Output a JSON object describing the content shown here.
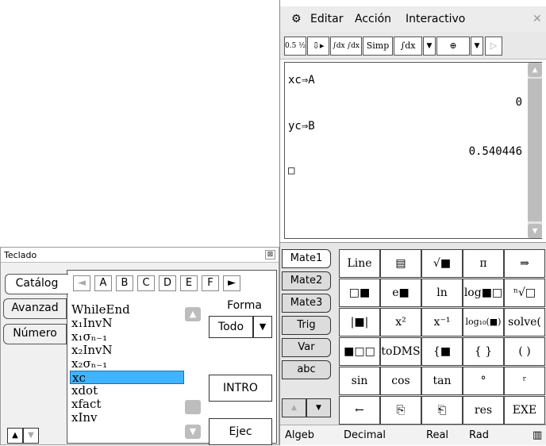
{
  "keyboard_window": {
    "title": "Teclado",
    "close": "⊠",
    "tabs": [
      "Catálog",
      "Avanzad",
      "Número"
    ],
    "letters": [
      "◄",
      "A",
      "B",
      "C",
      "D",
      "E",
      "F",
      "►"
    ],
    "list": [
      "WhileEnd",
      "x₁InvN",
      "x₁σₙ₋₁",
      "x₂InvN",
      "x₂σₙ₋₁",
      "xc",
      "xdot",
      "xfact",
      "xInv"
    ],
    "selected": "xc",
    "form_label": "Forma",
    "form_value": "Todo",
    "form_arrow": "▼",
    "intro": "INTRO",
    "exec": "Ejec",
    "scroll_up": "▲",
    "scroll_down": "▼"
  },
  "classpad": {
    "menu": {
      "gear": "⚙",
      "items": [
        "Editar",
        "Acción",
        "Interactivo"
      ],
      "close": "✕"
    },
    "toolbar": [
      "0.5 ½",
      "⇩▸",
      "∫dx ∫dx",
      "Simp",
      "∫dx",
      "▼",
      "⊕",
      "▼",
      "▷"
    ],
    "work": {
      "lines": [
        {
          "text": "xc⇒A",
          "align": "left"
        },
        {
          "text": "0",
          "align": "right"
        },
        {
          "text": "yc⇒B",
          "align": "left"
        },
        {
          "text": "0.540446",
          "align": "right"
        },
        {
          "text": "□",
          "align": "left"
        }
      ],
      "scroll_up": "▲",
      "scroll_down": "▼"
    },
    "keyboard": {
      "tabs": [
        "Mate1",
        "Mate2",
        "Mate3",
        "Trig",
        "Var",
        "abc"
      ],
      "active_tab": "Mate1",
      "nav": [
        "▲",
        "▼"
      ],
      "keys": [
        [
          "Line",
          "▤",
          "√■",
          "π",
          "⇒"
        ],
        [
          "□■",
          "e■",
          "ln",
          "log■□",
          "ⁿ√□"
        ],
        [
          "|■|",
          "x²",
          "x⁻¹",
          "log₁₀(■)",
          "solve("
        ],
        [
          "■□□",
          "toDMS",
          "{■",
          "{ }",
          "( )"
        ],
        [
          "sin",
          "cos",
          "tan",
          "°",
          "ʳ"
        ],
        [
          "←",
          "⎘",
          "⎗",
          "res",
          "EXE"
        ]
      ]
    },
    "status": [
      "Algeb",
      "Decimal",
      "Real",
      "Rad",
      "▥"
    ]
  }
}
